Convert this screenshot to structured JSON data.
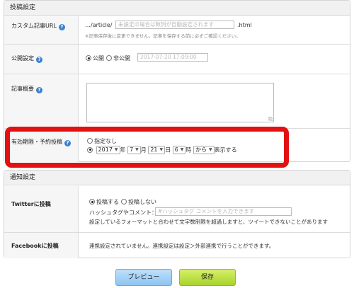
{
  "post_settings": {
    "header": "投稿設定",
    "custom_url": {
      "label": "カスタム記事URL",
      "prefix": "…/article/",
      "placeholder": "未設定の場合は数列が自動設定されます",
      "suffix": ".html",
      "note": "※記事保存後に変更できません。記事を保存する前に必ずご確認ください。"
    },
    "visibility": {
      "label": "公開設定",
      "option_public": "公開",
      "option_private": "非公開",
      "selected": "公開",
      "datetime": "2017-07-20 17:09:00"
    },
    "summary": {
      "label": "記事概要"
    },
    "schedule": {
      "label": "有効期限・予約投稿",
      "option_none": "指定なし",
      "selected": "date",
      "year": "2017",
      "year_unit": "年",
      "month": "7",
      "month_unit": "月",
      "day": "21",
      "day_unit": "日",
      "hour": "6",
      "hour_unit": "時",
      "mode": "から",
      "mode_suffix": "表示する"
    }
  },
  "notify_settings": {
    "header": "通知設定",
    "twitter": {
      "label": "Twitterに投稿",
      "option_post": "投稿する",
      "option_no_post": "投稿しない",
      "selected": "投稿する",
      "hashtag_label": "ハッシュタグやコメント：",
      "hashtag_placeholder": "#ハッシュタグ コメントを入力できます",
      "warning": "設定しているフォーマットと合わせて文字数制限を超過しますと、ツイートできないことがあります"
    },
    "facebook": {
      "label": "Facebookに投稿",
      "message": "連携設定されていません。連携設定は設定＞外部連携で行うことができます。"
    }
  },
  "buttons": {
    "preview": "プレビュー",
    "save": "保存"
  },
  "colors": {
    "highlight": "#e21212",
    "help_icon": "#3a82d1",
    "save_button": "#a7d22b",
    "preview_button": "#8cc4f2"
  }
}
